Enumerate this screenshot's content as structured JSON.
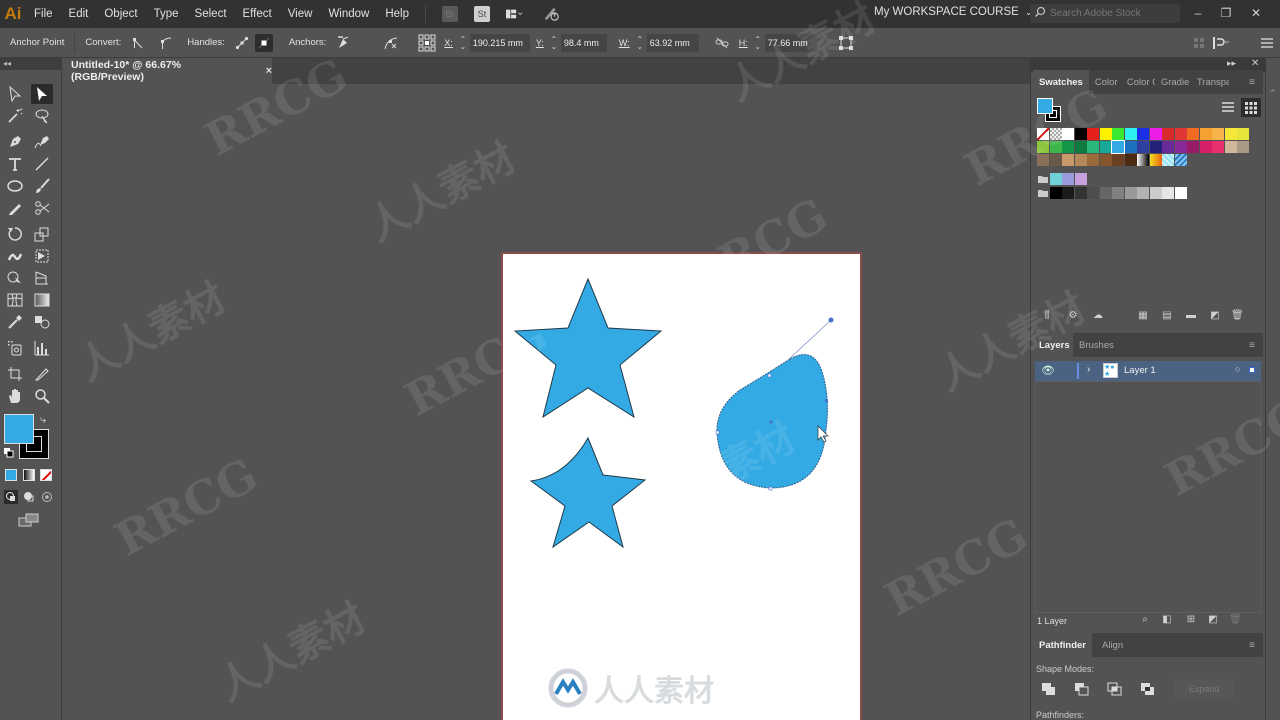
{
  "app": {
    "logo": "Ai",
    "menu": [
      "File",
      "Edit",
      "Object",
      "Type",
      "Select",
      "Effect",
      "View",
      "Window",
      "Help"
    ],
    "bridge_icon": "Br",
    "stock_icon": "St",
    "workspace": "My WORKSPACE COURSE",
    "search_placeholder": "Search Adobe Stock",
    "window_controls": {
      "minimize": "–",
      "restore": "❐",
      "close": "✕"
    }
  },
  "control_bar": {
    "tool_name": "Anchor Point",
    "convert_label": "Convert:",
    "handles_label": "Handles:",
    "anchors_label": "Anchors:",
    "x_label": "X:",
    "x_value": "190.215 mm",
    "y_label": "Y:",
    "y_value": "98.4 mm",
    "w_label": "W:",
    "w_value": "63.92 mm",
    "h_label": "H:",
    "h_value": "77.66 mm"
  },
  "document": {
    "tab_title": "Untitled-10* @ 66.67% (RGB/Preview)",
    "close": "×"
  },
  "colors": {
    "fill": "#33aae3",
    "stroke": "#000000",
    "artboard_border": "#8a4b4b",
    "accent_selection": "#4a6fcf"
  },
  "artwork": {
    "objects": [
      "star",
      "star-with-curved-arm",
      "teardrop-blob"
    ]
  },
  "swatches_panel": {
    "tabs": [
      "Swatches",
      "Color",
      "Color G",
      "Gradie",
      "Transpa"
    ],
    "active_tab": "Swatches",
    "rows": [
      [
        "none",
        "registration",
        "#ffffff",
        "#000000",
        "#e8201c",
        "#fff200",
        "#39e830",
        "#2ef0f0",
        "#1a2ee8",
        "#ee1ee8",
        "#d92b2b",
        "#e03636",
        "#f06a22",
        "#f5a030",
        "#f7b24a",
        "#f5e63a",
        "#e5e53a"
      ],
      [
        "#8cc63f",
        "#3db54a",
        "#12964a",
        "#0f7a3f",
        "#2ab57a",
        "#18a898",
        "#33aae3",
        "#1d6fbf",
        "#2f3f9f",
        "#23237a",
        "#6a2a9a",
        "#8a2a9a",
        "#9a1a6a",
        "#d8206a",
        "#e8306f",
        "#d2b89a",
        "#a89a86"
      ],
      [
        "#8a7058",
        "#6a5848",
        "#c89a6a",
        "#b5885a",
        "#9a6a3a",
        "#855530",
        "#6a4020",
        "#4a2a10",
        "gradient-bw",
        "gradient-orange",
        "pattern-cyan",
        "pattern-blue"
      ],
      [
        "folder",
        "#6fd0d8",
        "#9a9adf",
        "#c8a0e0"
      ],
      [
        "folder",
        "#000000",
        "#1a1a1a",
        "#333333",
        "#4d4d4d",
        "#666666",
        "#808080",
        "#999999",
        "#b3b3b3",
        "#cccccc",
        "#e6e6e6",
        "#ffffff"
      ]
    ]
  },
  "layers_panel": {
    "tabs": [
      "Layers",
      "Brushes"
    ],
    "active_tab": "Layers",
    "layers": [
      {
        "name": "Layer 1",
        "visible": true
      }
    ],
    "footer_count": "1 Layer"
  },
  "pathfinder_panel": {
    "tabs": [
      "Pathfinder",
      "Align"
    ],
    "active_tab": "Pathfinder",
    "shape_modes_label": "Shape Modes:",
    "expand_label": "Expand",
    "pathfinders_label": "Pathfinders:"
  },
  "watermarks": {
    "latin": "RRCG",
    "cn": "人人素材"
  }
}
